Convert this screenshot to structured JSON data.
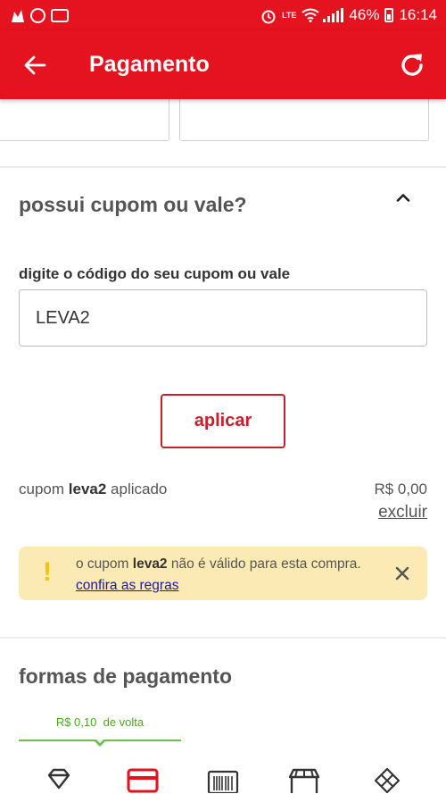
{
  "status_bar": {
    "battery": "46%",
    "time": "16:14",
    "network": "LTE"
  },
  "app_bar": {
    "title": "Pagamento",
    "icons": [
      "back-arrow-icon",
      "refresh-icon"
    ]
  },
  "coupon_section": {
    "title": "possui cupom ou vale?",
    "input_label": "digite o código do seu cupom ou vale",
    "input_value": "LEVA2",
    "apply_label": "aplicar",
    "applied_prefix": "cupom",
    "applied_code": "leva2",
    "applied_suffix": "aplicado",
    "applied_value": "R$ 0,00",
    "remove_label": "excluir"
  },
  "alert": {
    "prefix": "o cupom",
    "code": "leva2",
    "message": "não é válido para esta compra.",
    "link_label": "confira as regras"
  },
  "payment_section": {
    "title": "formas de pagamento",
    "cashback_value": "R$ 0,10",
    "cashback_label": "de volta",
    "methods": [
      "diamond-icon",
      "credit-card-icon",
      "barcode-icon",
      "store-icon",
      "pix-icon"
    ]
  },
  "colors": {
    "brand": "#e5131f",
    "button_border": "#c8202b",
    "alert_bg": "#fbeab3",
    "alert_icon": "#f1c40f",
    "cashback": "#4aa61f"
  }
}
